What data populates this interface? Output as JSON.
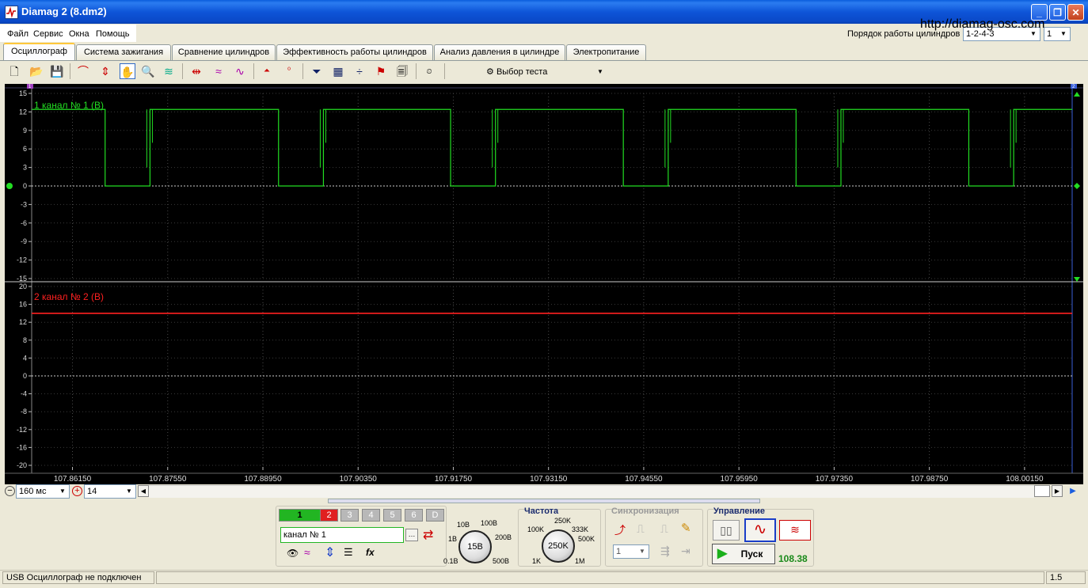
{
  "window": {
    "title": "Diamag 2 (8.dm2)",
    "url_overlay": "http://diamag-osc.com"
  },
  "menu": [
    "Файл",
    "Сервис",
    "Окна",
    "Помощь"
  ],
  "cylinder_order": {
    "label": "Порядок работы цилиндров",
    "value": "1-2-4-3",
    "cylinder": "1"
  },
  "tabs": [
    "Осциллограф",
    "Система зажигания",
    "Сравнение цилиндров",
    "Эффективность работы цилиндров",
    "Анализ давления в цилиндре",
    "Электропитание"
  ],
  "active_tab": "Осциллограф",
  "toolbar": {
    "test_select": "Выбор теста"
  },
  "markers": {
    "left": "1",
    "right": "2"
  },
  "channel1": {
    "label": "1 канал № 1 (В)",
    "color": "#22dd22",
    "y_ticks": [
      "15",
      "12",
      "9",
      "6",
      "3",
      "0",
      "-3",
      "-6",
      "-9",
      "-12",
      "-15"
    ],
    "ylim": [
      -15,
      15
    ]
  },
  "channel2": {
    "label": "2 канал № 2 (В)",
    "color": "#ff2020",
    "y_ticks": [
      "20",
      "16",
      "12",
      "8",
      "4",
      "0",
      "-4",
      "-8",
      "-12",
      "-16",
      "-20"
    ],
    "ylim": [
      -20,
      20
    ]
  },
  "x_ticks": [
    "107.86150",
    "107.87550",
    "107.88950",
    "107.90350",
    "107.91750",
    "107.93150",
    "107.94550",
    "107.95950",
    "107.97350",
    "107.98750",
    "108.00150"
  ],
  "chart_data": [
    {
      "type": "line",
      "title": "1 канал № 1 (В)",
      "xlim": [
        107.8555,
        108.0085
      ],
      "ylim": [
        -15,
        15
      ],
      "series": [
        {
          "name": "1 канал № 1 (В)",
          "high": 12.4,
          "low": 0,
          "transitions": [
            {
              "x": 107.8663,
              "to": 0
            },
            {
              "x": 107.8729,
              "to": 12.4
            },
            {
              "x": 107.8918,
              "to": 0
            },
            {
              "x": 107.8984,
              "to": 12.4
            },
            {
              "x": 107.9171,
              "to": 0
            },
            {
              "x": 107.9237,
              "to": 12.4
            },
            {
              "x": 107.9425,
              "to": 0
            },
            {
              "x": 107.9491,
              "to": 12.4
            },
            {
              "x": 107.9679,
              "to": 0
            },
            {
              "x": 107.9745,
              "to": 12.4
            },
            {
              "x": 107.9933,
              "to": 0
            },
            {
              "x": 107.9999,
              "to": 12.4
            }
          ]
        }
      ]
    },
    {
      "type": "line",
      "title": "2 канал № 2 (В)",
      "xlim": [
        107.8555,
        108.0085
      ],
      "ylim": [
        -20,
        20
      ],
      "series": [
        {
          "name": "2 канал № 2 (В)",
          "constant": 14.0
        }
      ]
    }
  ],
  "bottom": {
    "timebase": "160 мс",
    "zoom": "14",
    "channel_buttons": [
      "1",
      "2",
      "3",
      "4",
      "5",
      "6",
      "D"
    ],
    "channel_name": "канал № 1",
    "voltage": {
      "value": "15В",
      "labels": [
        "0.1В",
        "1В",
        "10В",
        "100В",
        "200В",
        "500В"
      ]
    },
    "frequency": {
      "title": "Частота",
      "value": "250K",
      "labels": [
        "1K",
        "100K",
        "250K",
        "333K",
        "500K",
        "1M"
      ]
    },
    "sync": {
      "title": "Синхронизация",
      "value": "1"
    },
    "control": {
      "title": "Управление",
      "start": "Пуск",
      "reading": "108.38"
    }
  },
  "status": {
    "text": "USB Осциллограф не подключен",
    "right": "1.5"
  }
}
